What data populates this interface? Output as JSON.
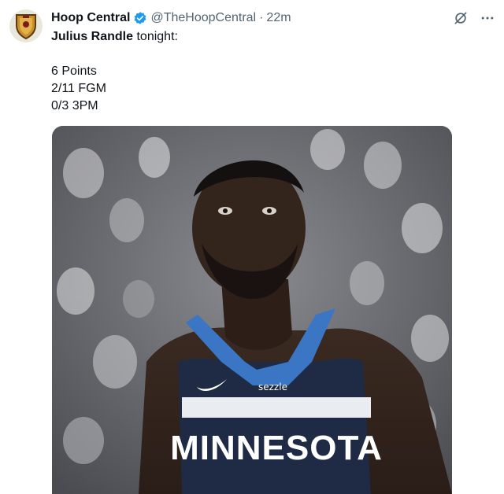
{
  "account": {
    "name": "Hoop Central",
    "handle": "@TheHoopCentral",
    "separator": "·",
    "time": "22m",
    "avatar_icon": "shield-logo-icon",
    "verified_icon": "verified-badge-icon"
  },
  "toolbar": {
    "grok_icon": "grok-icon",
    "more_icon": "more-options-icon"
  },
  "tweet": {
    "subject": "Julius Randle",
    "rest": " tonight:",
    "stats": [
      "6 Points",
      "2/11 FGM",
      "0/3 3PM"
    ]
  },
  "media": {
    "jersey_text": "MINNESOTA",
    "sponsor_text": "sezzle",
    "accent_color": "#1d9bf0",
    "jersey_color": "#1f2a44"
  }
}
